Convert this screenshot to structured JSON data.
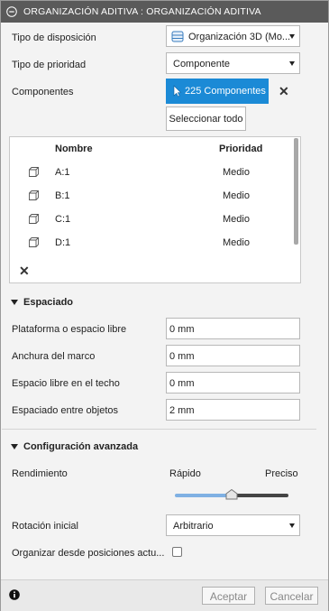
{
  "title": "ORGANIZACIÓN ADITIVA : ORGANIZACIÓN ADITIVA",
  "fields": {
    "tipo_disposicion": {
      "label": "Tipo de disposición",
      "value": "Organización 3D (Mo..."
    },
    "tipo_prioridad": {
      "label": "Tipo de prioridad",
      "value": "Componente"
    },
    "componentes": {
      "label": "Componentes",
      "selection_label": "225 Componentes",
      "select_all_label": "Seleccionar todo"
    }
  },
  "table": {
    "headers": [
      "Nombre",
      "Prioridad"
    ],
    "rows": [
      {
        "name": "A:1",
        "priority": "Medio"
      },
      {
        "name": "B:1",
        "priority": "Medio"
      },
      {
        "name": "C:1",
        "priority": "Medio"
      },
      {
        "name": "D:1",
        "priority": "Medio"
      }
    ]
  },
  "espaciado": {
    "title": "Espaciado",
    "rows": [
      {
        "label": "Plataforma o espacio libre",
        "value": "0 mm"
      },
      {
        "label": "Anchura del marco",
        "value": "0 mm"
      },
      {
        "label": "Espacio libre en el techo",
        "value": "0 mm"
      },
      {
        "label": "Espaciado entre objetos",
        "value": "2 mm"
      }
    ]
  },
  "avanzada": {
    "title": "Configuración avanzada",
    "rendimiento": {
      "label": "Rendimiento",
      "min_label": "Rápido",
      "max_label": "Preciso",
      "level": 0.5
    },
    "rotacion": {
      "label": "Rotación inicial",
      "value": "Arbitrario"
    },
    "organizar": {
      "label": "Organizar desde posiciones actu...",
      "checked": false
    }
  },
  "footer": {
    "ok": "Aceptar",
    "cancel": "Cancelar"
  },
  "colors": {
    "accent": "#1b8ad6",
    "titlebar": "#5a5a5a"
  }
}
